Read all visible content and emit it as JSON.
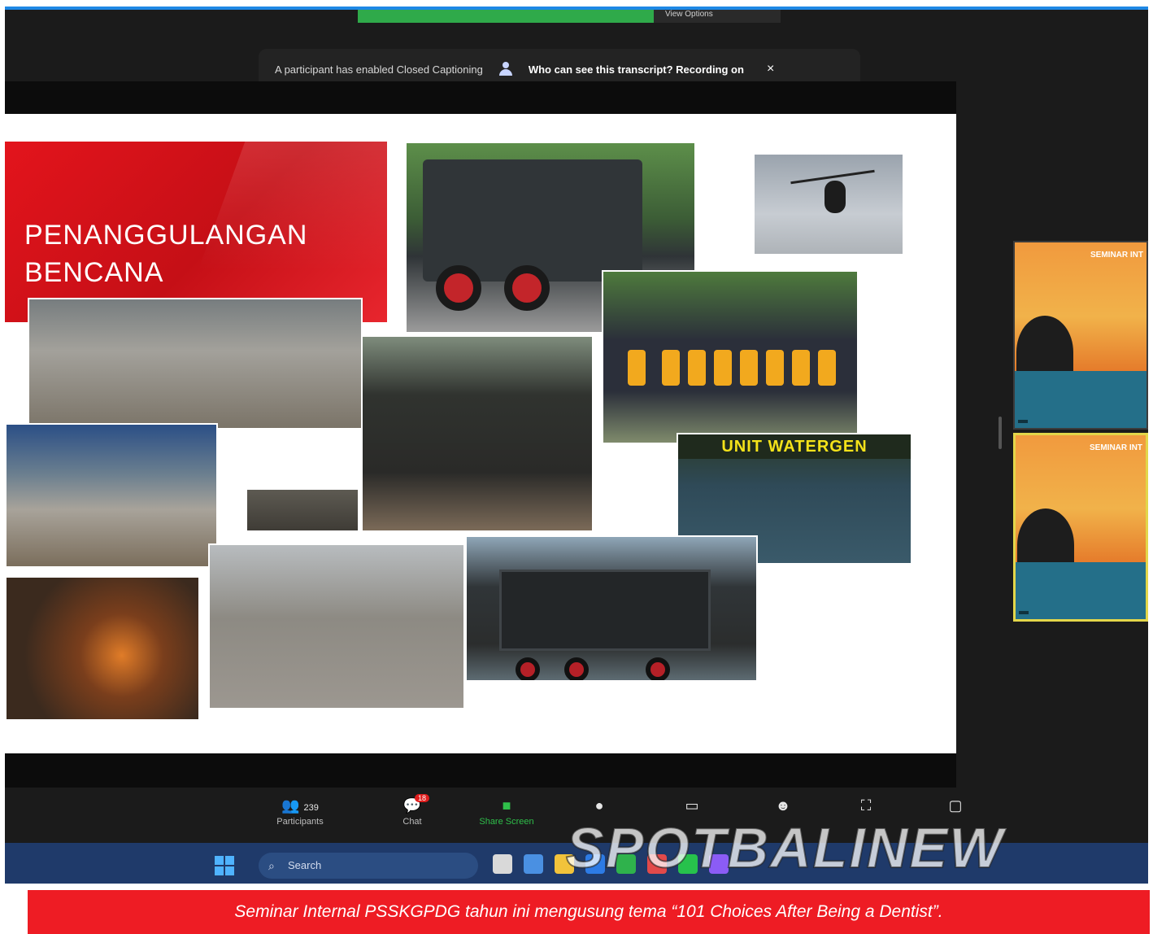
{
  "zoom": {
    "top_banner": {
      "status_text": "",
      "view_label": "View Options"
    },
    "cc_notice": {
      "message": "A participant has enabled Closed Captioning",
      "link": "Who can see this transcript? Recording on",
      "close": "×"
    },
    "slide": {
      "title": "PENANGGULANGAN\nBENCANA",
      "water_unit_title": "UNIT WATERGEN"
    },
    "video_tiles": [
      {
        "heading": "SEMINAR INT",
        "name": ""
      },
      {
        "heading": "SEMINAR INT",
        "name": ""
      }
    ],
    "toolbar": {
      "participants_label": "Participants",
      "participants_count": "239",
      "chat_label": "Chat",
      "chat_badge": "18",
      "share_label": "Share Screen"
    }
  },
  "taskbar": {
    "search_placeholder": "Search"
  },
  "watermark": "SPOTBALINEW",
  "caption": "Seminar Internal PSSKGPDG tahun ini mengusung tema “101 Choices After Being a Dentist”.",
  "colors": {
    "caption_bg": "#ee1c24",
    "accent_blue": "#1e88e5",
    "share_green": "#2fbf4a"
  }
}
